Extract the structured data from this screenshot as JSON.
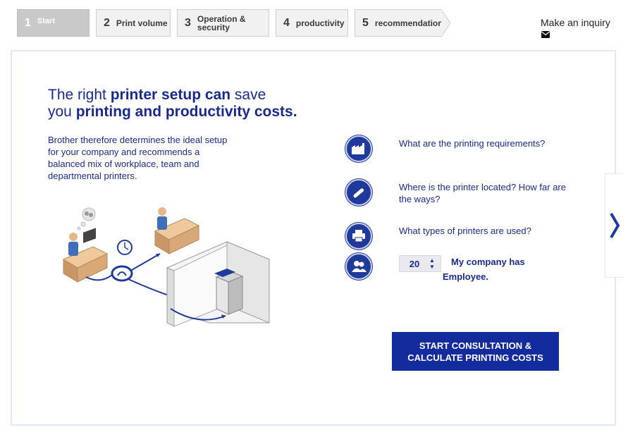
{
  "steps": [
    {
      "num": "1",
      "label": "Start",
      "active": true
    },
    {
      "num": "2",
      "label": "Print volume",
      "active": false
    },
    {
      "num": "3",
      "label_line1": "Operation &",
      "label_line2": "security",
      "active": false
    },
    {
      "num": "4",
      "label": "productivity",
      "active": false
    },
    {
      "num": "5",
      "label": "recommendation",
      "active": false
    }
  ],
  "inquiry": {
    "label": "Make an inquiry",
    "icon": "envelope-icon"
  },
  "headline": {
    "line1_a": "The right ",
    "line1_b": "printer setup can",
    "line1_c": " save",
    "line2_a": "you ",
    "line2_b": "printing and productivity costs."
  },
  "intro": "Brother therefore determines the ideal setup for your company and recommends a balanced mix of workplace, team and departmental printers.",
  "questions": [
    {
      "icon": "factory-icon",
      "text": "What are the printing requirements?"
    },
    {
      "icon": "location-icon",
      "text": "Where is the printer located? How far are the ways?"
    },
    {
      "icon": "printer-icon",
      "text": "What types of printers are used?"
    }
  ],
  "employees": {
    "icon": "people-icon",
    "value": "20",
    "label1": "My company has",
    "label2": "Employee."
  },
  "cta": {
    "line1": "START CONSULTATION &",
    "line2": "CALCULATE PRINTING COSTS"
  },
  "next": {
    "icon": "chevron-right-icon"
  },
  "colors": {
    "brand": "#142b9d",
    "text": "#1a2a8c"
  }
}
